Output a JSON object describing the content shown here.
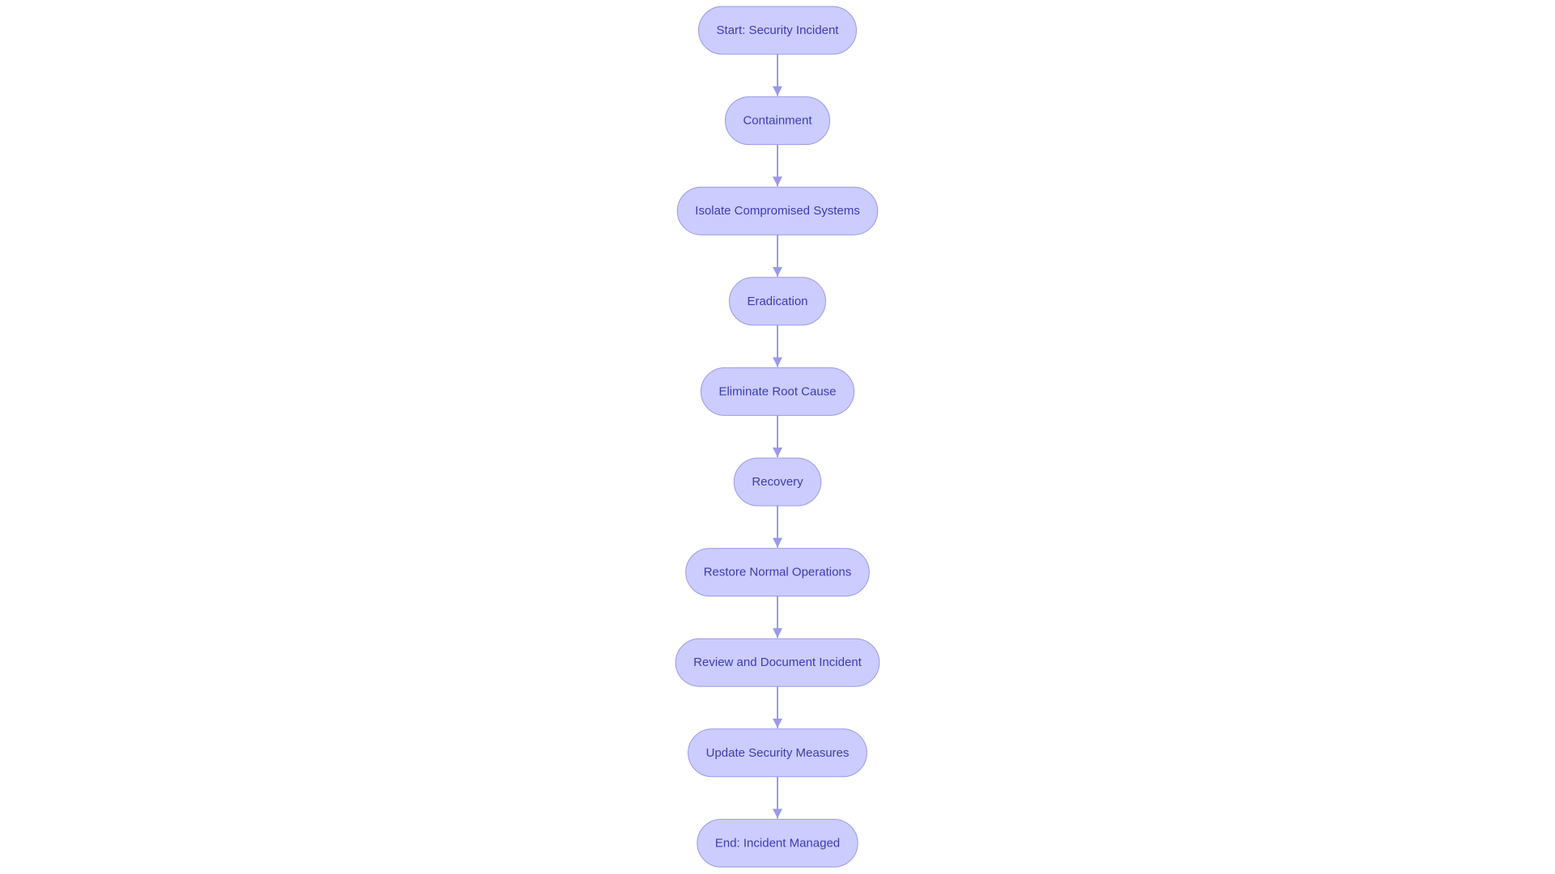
{
  "diagram": {
    "type": "flowchart",
    "direction": "top-to-bottom",
    "colors": {
      "background": "#ffffff",
      "node_fill": "#ccccff",
      "node_border": "#9a9ae8",
      "node_text": "#3c3cb4",
      "edge": "#9a9ae8"
    },
    "nodes": [
      {
        "id": "start",
        "label": "Start: Security Incident"
      },
      {
        "id": "containment",
        "label": "Containment"
      },
      {
        "id": "isolate",
        "label": "Isolate Compromised Systems"
      },
      {
        "id": "eradication",
        "label": "Eradication"
      },
      {
        "id": "eliminate",
        "label": "Eliminate Root Cause"
      },
      {
        "id": "recovery",
        "label": "Recovery"
      },
      {
        "id": "restore",
        "label": "Restore Normal Operations"
      },
      {
        "id": "review",
        "label": "Review and Document Incident"
      },
      {
        "id": "update",
        "label": "Update Security Measures"
      },
      {
        "id": "end",
        "label": "End: Incident Managed"
      }
    ],
    "edges": [
      {
        "from": "start",
        "to": "containment"
      },
      {
        "from": "containment",
        "to": "isolate"
      },
      {
        "from": "isolate",
        "to": "eradication"
      },
      {
        "from": "eradication",
        "to": "eliminate"
      },
      {
        "from": "eliminate",
        "to": "recovery"
      },
      {
        "from": "recovery",
        "to": "restore"
      },
      {
        "from": "restore",
        "to": "review"
      },
      {
        "from": "review",
        "to": "update"
      },
      {
        "from": "update",
        "to": "end"
      }
    ]
  }
}
